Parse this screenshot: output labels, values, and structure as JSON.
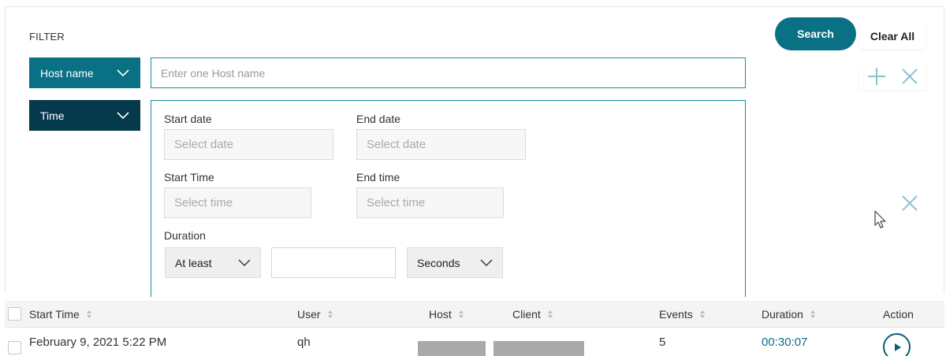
{
  "filter": {
    "title": "FILTER",
    "search_label": "Search",
    "clear_label": "Clear All",
    "host_dropdown_label": "Host name",
    "host_placeholder": "Enter one Host name",
    "time_dropdown_label": "Time",
    "start_date_label": "Start date",
    "start_date_placeholder": "Select date",
    "end_date_label": "End date",
    "end_date_placeholder": "Select date",
    "start_time_label": "Start Time",
    "start_time_placeholder": "Select time",
    "end_time_label": "End time",
    "end_time_placeholder": "Select time",
    "duration_label": "Duration",
    "duration_operator": "At least",
    "duration_value": "",
    "duration_unit": "Seconds"
  },
  "table": {
    "columns": [
      "Start Time",
      "User",
      "Host",
      "Client",
      "Events",
      "Duration",
      "Action"
    ],
    "rows": [
      {
        "start_time": "February 9, 2021 5:22 PM",
        "user": "qh",
        "host": "",
        "client": "",
        "events": "5",
        "duration": "00:30:07"
      }
    ]
  },
  "colors": {
    "accent": "#0a7083",
    "dark_accent": "#053a4c",
    "duration_link": "#0a6f8a",
    "icon_light": "#8cc3cf"
  }
}
